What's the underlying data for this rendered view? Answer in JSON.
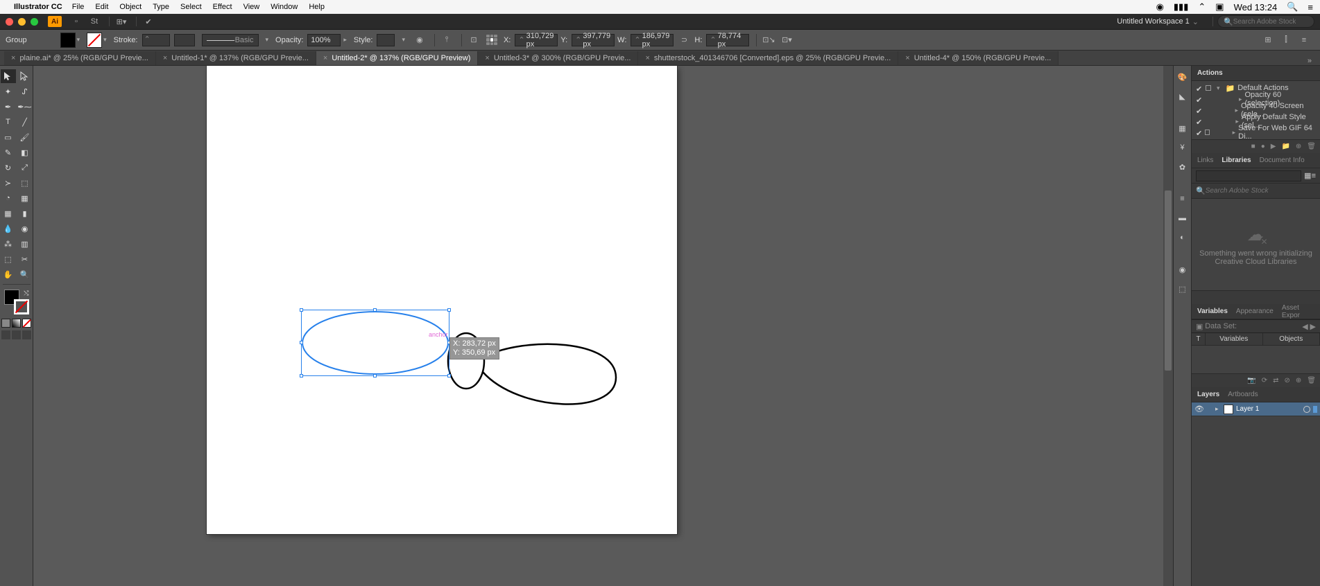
{
  "menubar": {
    "app": "Illustrator CC",
    "items": [
      "File",
      "Edit",
      "Object",
      "Type",
      "Select",
      "Effect",
      "View",
      "Window",
      "Help"
    ],
    "clock": "Wed 13:24"
  },
  "titlebar": {
    "workspace": "Untitled Workspace 1",
    "search_placeholder": "Search Adobe Stock"
  },
  "controlbar": {
    "selection": "Group",
    "stroke_label": "Stroke:",
    "brush_style": "Basic",
    "opacity_label": "Opacity:",
    "opacity_value": "100%",
    "style_label": "Style:",
    "x_label": "X:",
    "x_value": "310,729 px",
    "y_label": "Y:",
    "y_value": "397,779 px",
    "w_label": "W:",
    "w_value": "186,979 px",
    "h_label": "H:",
    "h_value": "78,774 px"
  },
  "tabs": [
    "plaine.ai* @ 25% (RGB/GPU Previe...",
    "Untitled-1* @ 137% (RGB/GPU Previe...",
    "Untitled-2* @ 137% (RGB/GPU Preview)",
    "Untitled-3* @ 300% (RGB/GPU Previe...",
    "shutterstock_401346706 [Converted].eps @ 25% (RGB/GPU Previe...",
    "Untitled-4* @ 150% (RGB/GPU Previe..."
  ],
  "active_tab_index": 2,
  "canvas": {
    "anchor_label": "anchor",
    "tooltip_x": "X: 283,72 px",
    "tooltip_y": "Y: 350,69 px"
  },
  "panels": {
    "actions": {
      "tab": "Actions",
      "set": "Default Actions",
      "items": [
        "Opacity 60 (selection)",
        "Opacity 40 Screen (sele...",
        "Apply Default Style (sel...",
        "Save For Web GIF 64 Di..."
      ]
    },
    "links_tab": "Links",
    "libraries_tab": "Libraries",
    "docinfo_tab": "Document Info",
    "lib_search_placeholder": "Search Adobe Stock",
    "lib_error1": "Something went wrong initializing",
    "lib_error2": "Creative Cloud Libraries",
    "variables_tab": "Variables",
    "appearance_tab": "Appearance",
    "assetexport_tab": "Asset Expor",
    "dataset_label": "Data Set:",
    "var_col_t": "T",
    "var_col_vars": "Variables",
    "var_col_objs": "Objects",
    "layers_tab": "Layers",
    "artboards_tab": "Artboards",
    "layer1": "Layer 1"
  }
}
